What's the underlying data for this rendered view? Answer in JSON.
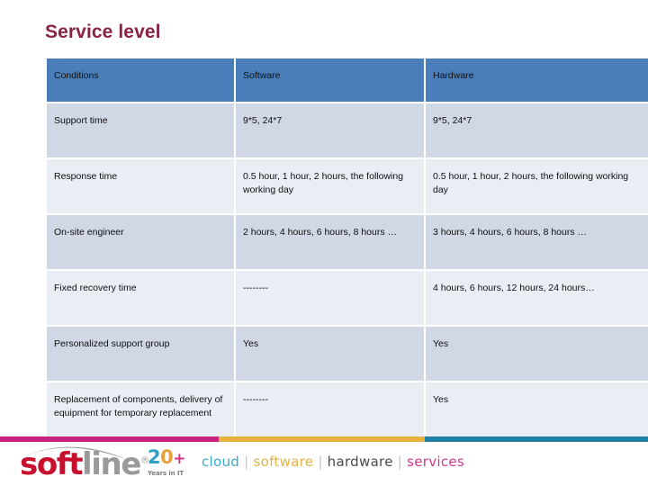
{
  "slide": {
    "title": "Service level"
  },
  "table": {
    "columns": [
      {
        "key": "conditions",
        "label": "Conditions"
      },
      {
        "key": "software",
        "label": "Software"
      },
      {
        "key": "hardware",
        "label": "Hardware"
      }
    ],
    "rows": [
      {
        "conditions": "Support time",
        "software": "9*5, 24*7",
        "hardware": "9*5, 24*7"
      },
      {
        "conditions": "Response time",
        "software": "0.5 hour, 1 hour, 2 hours, the following working day",
        "hardware": "0.5 hour, 1 hour, 2 hours, the following working day"
      },
      {
        "conditions": "On-site engineer",
        "software": "2 hours, 4 hours, 6 hours, 8 hours …",
        "hardware": "3 hours, 4 hours, 6 hours, 8 hours …"
      },
      {
        "conditions": "Fixed recovery time",
        "software": "--------",
        "hardware": "4 hours, 6 hours, 12 hours, 24 hours…"
      },
      {
        "conditions": "Personalized support group",
        "software": "Yes",
        "hardware": "Yes"
      },
      {
        "conditions": "Replacement of components, delivery of equipment for temporary replacement",
        "software": "--------",
        "hardware": "Yes"
      }
    ]
  },
  "footer": {
    "logo": {
      "soft": "soft",
      "line": "line",
      "registered": "®"
    },
    "anniversary": {
      "number_2": "2",
      "number_0": "0",
      "plus": "+",
      "subtitle": "Years in IT"
    },
    "tagline": {
      "cloud": "cloud",
      "software": "software",
      "hardware": "hardware",
      "services": "services",
      "separator": "|"
    },
    "bar_colors": {
      "magenta": "#c6237e",
      "yellow": "#e8b33c",
      "teal": "#1f7fa5"
    }
  },
  "colors": {
    "title": "#8c2343",
    "table_header_bg": "#4a7ebb",
    "row_odd_bg": "#d0d7e5",
    "row_even_bg": "#e9edf4"
  }
}
